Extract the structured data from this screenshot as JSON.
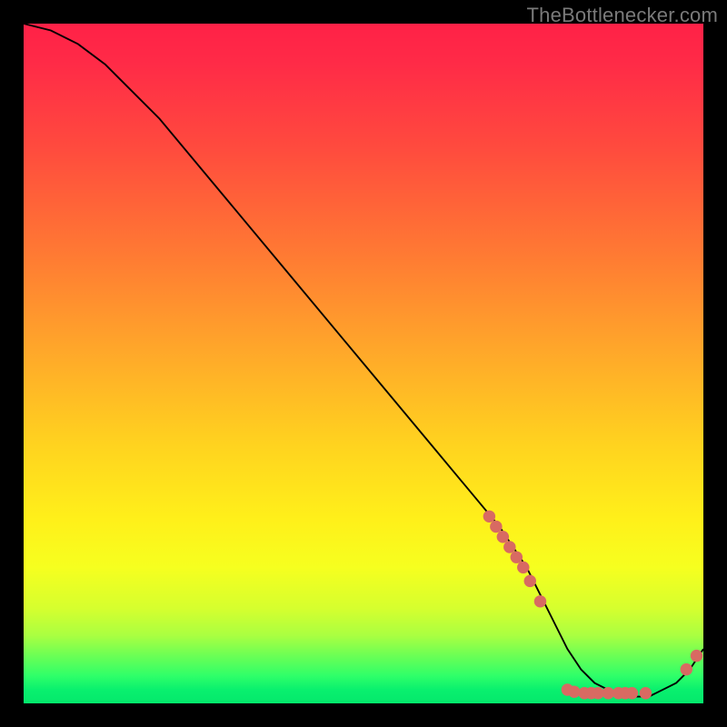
{
  "attribution": "TheBottlenecker.com",
  "chart_data": {
    "type": "line",
    "title": "",
    "xlabel": "",
    "ylabel": "",
    "xlim": [
      0,
      100
    ],
    "ylim": [
      0,
      100
    ],
    "series": [
      {
        "name": "bottleneck-curve",
        "x": [
          0,
          4,
          8,
          12,
          20,
          30,
          40,
          50,
          60,
          70,
          72,
          74,
          76,
          78,
          80,
          82,
          84,
          86,
          88,
          90,
          92,
          94,
          96,
          98,
          100
        ],
        "y": [
          100,
          99,
          97,
          94,
          86,
          74,
          62,
          50,
          38,
          26,
          23,
          20,
          16,
          12,
          8,
          5,
          3,
          2,
          1,
          1,
          1,
          2,
          3,
          5,
          8
        ]
      }
    ],
    "markers": [
      {
        "x": 68.5,
        "y": 27.5
      },
      {
        "x": 69.5,
        "y": 26.0
      },
      {
        "x": 70.5,
        "y": 24.5
      },
      {
        "x": 71.5,
        "y": 23.0
      },
      {
        "x": 72.5,
        "y": 21.5
      },
      {
        "x": 73.5,
        "y": 20.0
      },
      {
        "x": 74.5,
        "y": 18.0
      },
      {
        "x": 76.0,
        "y": 15.0
      },
      {
        "x": 80.0,
        "y": 2.0
      },
      {
        "x": 81.0,
        "y": 1.7
      },
      {
        "x": 82.5,
        "y": 1.5
      },
      {
        "x": 83.5,
        "y": 1.5
      },
      {
        "x": 84.5,
        "y": 1.5
      },
      {
        "x": 86.0,
        "y": 1.5
      },
      {
        "x": 87.5,
        "y": 1.5
      },
      {
        "x": 88.5,
        "y": 1.5
      },
      {
        "x": 89.5,
        "y": 1.5
      },
      {
        "x": 91.5,
        "y": 1.5
      },
      {
        "x": 97.5,
        "y": 5.0
      },
      {
        "x": 99.0,
        "y": 7.0
      }
    ],
    "marker_color": "#d86a62",
    "curve_color": "#000000",
    "background_gradient": {
      "top": "#ff2147",
      "mid": "#ffd31f",
      "bottom": "#04e86c"
    }
  }
}
